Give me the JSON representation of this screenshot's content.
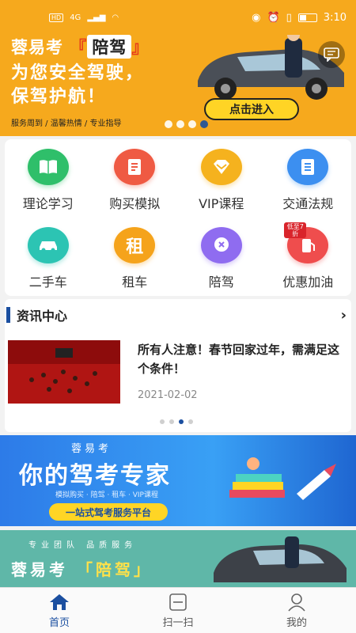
{
  "status_bar": {
    "network": "HD",
    "signal": "4G",
    "time": "3:10"
  },
  "banner": {
    "line1_prefix": "蓉易考",
    "line1_highlight": "陪驾",
    "line2": "为您安全驾驶，",
    "line3": "保驾护航！",
    "footer": "服务周到 / 温馨热情 / 专业指导",
    "enter_label": "点击进入",
    "accent_color": "#f6a91d"
  },
  "grid": {
    "items": [
      {
        "label": "理论学习",
        "icon": "book-icon",
        "color": "#2fbf6a"
      },
      {
        "label": "购买模拟",
        "icon": "document-icon",
        "color": "#ef5a43"
      },
      {
        "label": "VIP课程",
        "icon": "diamond-icon",
        "color": "#f5b21e"
      },
      {
        "label": "交通法规",
        "icon": "list-icon",
        "color": "#3c8ff0"
      },
      {
        "label": "二手车",
        "icon": "car-icon",
        "color": "#2cc4b3"
      },
      {
        "label": "租车",
        "icon": "rent-icon",
        "color": "#f5a31b",
        "glyph": "租"
      },
      {
        "label": "陪驾",
        "icon": "badge-icon",
        "color": "#8f6cf0"
      },
      {
        "label": "优惠加油",
        "icon": "fuel-icon",
        "color": "#ef4d4d",
        "tag": "低至7折"
      }
    ]
  },
  "news": {
    "section_title": "资讯中心",
    "headline": "所有人注意！春节回家过年，需满足这个条件！",
    "date": "2021-02-02"
  },
  "promo1": {
    "brand": "蓉易考",
    "headline": "你的驾考专家",
    "subline": "模拟购买 · 陪驾 · 租车 · VIP课程",
    "pill": "一站式驾考服务平台"
  },
  "promo2": {
    "tags": "专业团队  品质服务",
    "brand_prefix": "蓉易考",
    "brand_highlight": "「陪驾」"
  },
  "tabbar": {
    "items": [
      {
        "label": "首页",
        "icon": "home-icon",
        "active": true
      },
      {
        "label": "扫一扫",
        "icon": "scan-icon",
        "active": false
      },
      {
        "label": "我的",
        "icon": "user-icon",
        "active": false
      }
    ]
  },
  "colors": {
    "primary": "#1b4fa0",
    "banner_bg": "#f6a91d"
  }
}
